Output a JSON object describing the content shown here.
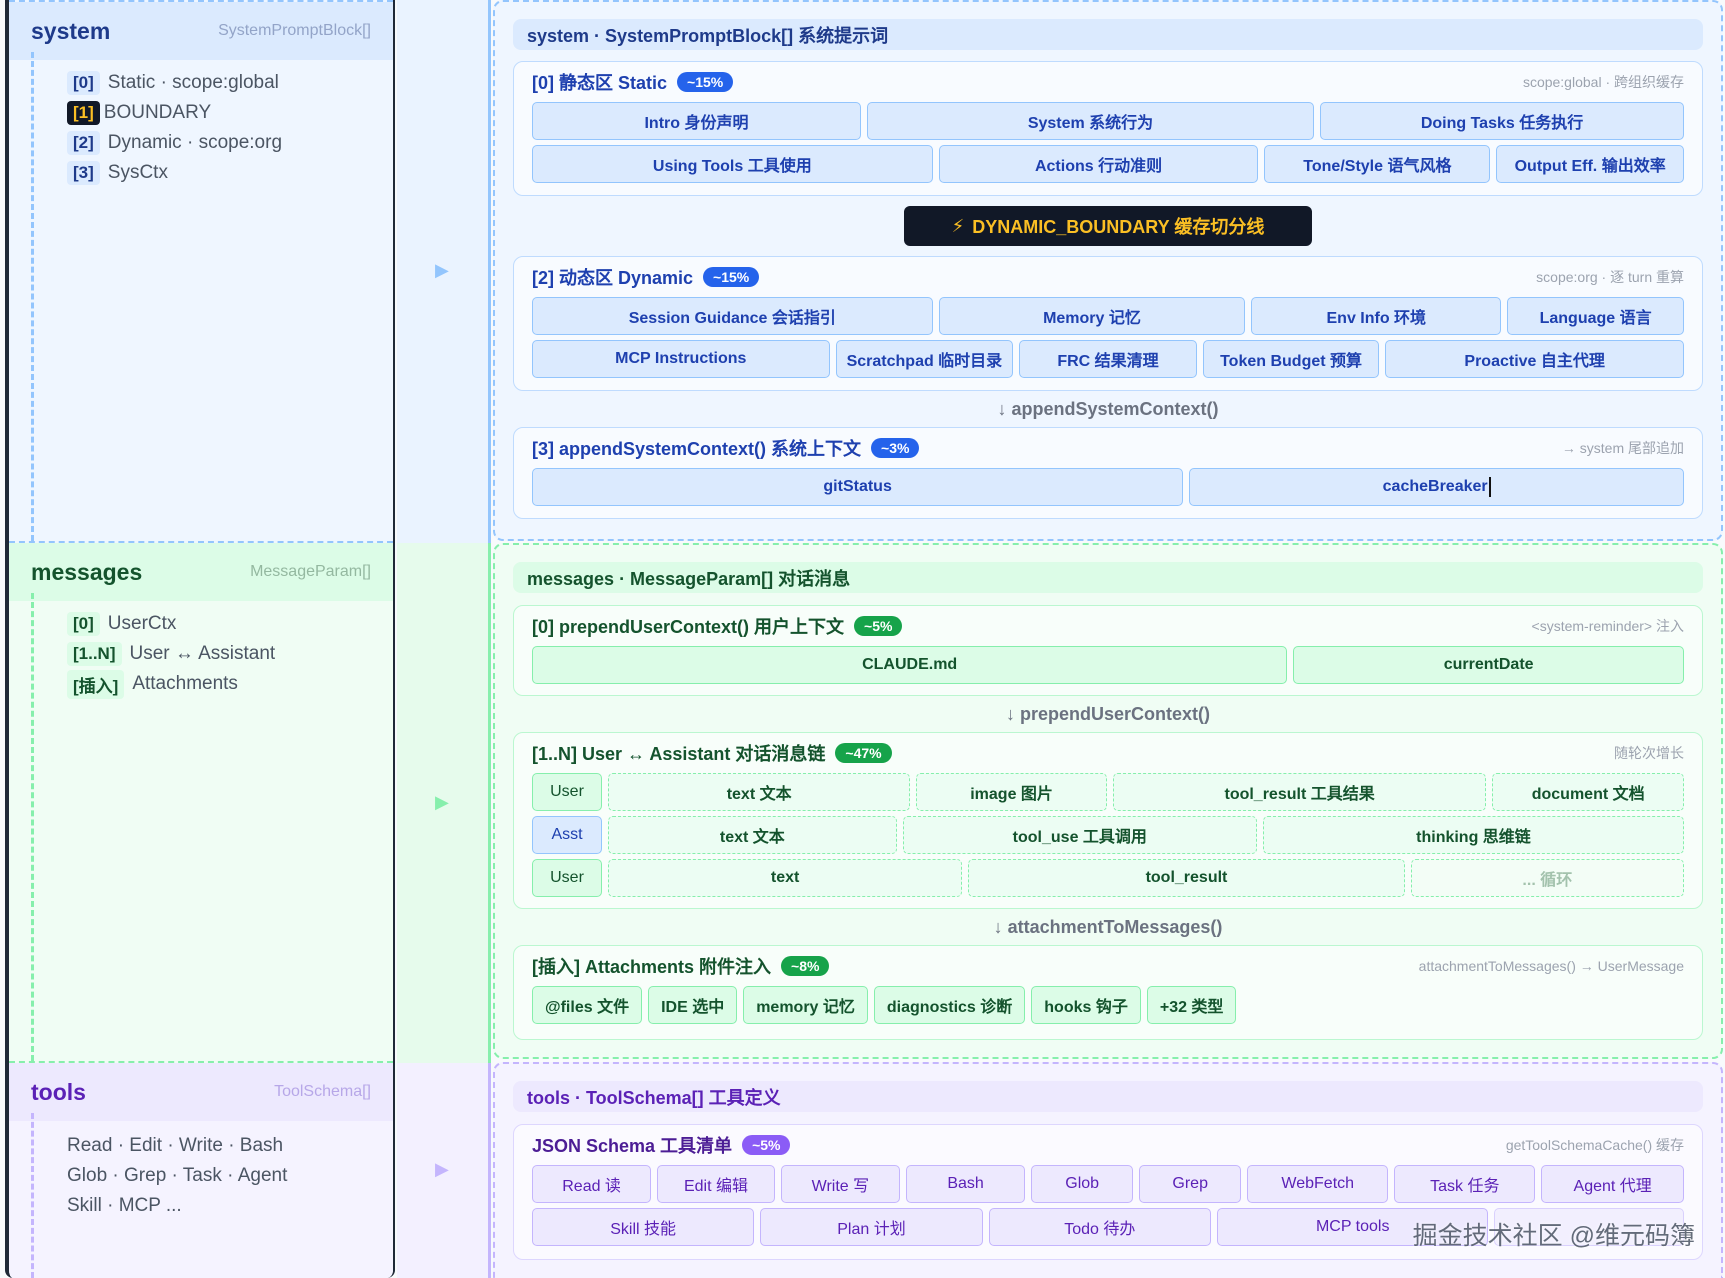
{
  "left": {
    "system": {
      "title": "system",
      "type": "SystemPromptBlock[]",
      "items": [
        {
          "idx": "[0]",
          "label": "Static · scope:global"
        },
        {
          "idx": "[1]",
          "label": "BOUNDARY"
        },
        {
          "idx": "[2]",
          "label": "Dynamic · scope:org"
        },
        {
          "idx": "[3]",
          "label": "SysCtx"
        }
      ]
    },
    "messages": {
      "title": "messages",
      "type": "MessageParam[]",
      "items": [
        {
          "idx": "[0]",
          "label": "UserCtx"
        },
        {
          "idx": "[1..N]",
          "label": "User ↔ Assistant"
        },
        {
          "idx": "[插入]",
          "label": "Attachments"
        }
      ]
    },
    "tools": {
      "title": "tools",
      "type": "ToolSchema[]",
      "lines": [
        "Read · Edit · Write · Bash",
        "Glob · Grep · Task · Agent",
        "Skill · MCP ..."
      ]
    }
  },
  "gutter": {
    "arrow_icon": "play-triangle",
    "colors": {
      "system": "#93c5fd",
      "messages": "#86efac",
      "tools": "#c4b5fd"
    }
  },
  "system": {
    "header": "system · SystemPromptBlock[] 系统提示词",
    "static": {
      "title": "[0] 静态区 Static",
      "badge": "~15%",
      "note": "scope:global · 跨组织缓存",
      "rows": [
        [
          "Intro 身份声明",
          "System 系统行为",
          "Doing Tasks 任务执行"
        ],
        [
          "Using Tools 工具使用",
          "Actions 行动准则",
          "Tone/Style 语气风格",
          "Output Eff. 输出效率"
        ]
      ]
    },
    "boundary": {
      "icon": "lightning-icon",
      "label": "DYNAMIC_BOUNDARY 缓存切分线"
    },
    "dynamic": {
      "title": "[2] 动态区 Dynamic",
      "badge": "~15%",
      "note": "scope:org · 逐 turn 重算",
      "rows": [
        [
          "Session Guidance 会话指引",
          "Memory 记忆",
          "Env Info 环境",
          "Language 语言"
        ],
        [
          "MCP Instructions",
          "Scratchpad 临时目录",
          "FRC 结果清理",
          "Token Budget 预算",
          "Proactive 自主代理"
        ]
      ]
    },
    "flow": "↓ appendSystemContext()",
    "append": {
      "title": "[3] appendSystemContext() 系统上下文",
      "badge": "~3%",
      "note": "→ system 尾部追加",
      "rows": [
        [
          "gitStatus",
          "cacheBreaker"
        ]
      ]
    }
  },
  "messages": {
    "header": "messages · MessageParam[] 对话消息",
    "prepend": {
      "title": "[0] prependUserContext() 用户上下文",
      "badge": "~5%",
      "note": "<system-reminder> 注入",
      "rows": [
        [
          "CLAUDE.md",
          "currentDate"
        ]
      ]
    },
    "flow1": "↓ prependUserContext()",
    "chain": {
      "title": "[1..N] User ↔ Assistant 对话消息链",
      "badge": "~47%",
      "note": "随轮次增长",
      "rows": [
        {
          "role": "User",
          "blocks": [
            "text 文本",
            "image 图片",
            "tool_result 工具结果",
            "document 文档"
          ]
        },
        {
          "role": "Asst",
          "blocks": [
            "text 文本",
            "tool_use 工具调用",
            "thinking 思维链"
          ]
        },
        {
          "role": "User",
          "blocks": [
            "text",
            "tool_result",
            "... 循环"
          ]
        }
      ]
    },
    "flow2": "↓ attachmentToMessages()",
    "attach": {
      "title": "[插入] Attachments 附件注入",
      "badge": "~8%",
      "note": "attachmentToMessages() → UserMessage",
      "rows": [
        [
          "@files 文件",
          "IDE 选中",
          "memory 记忆",
          "diagnostics 诊断",
          "hooks 钩子",
          "+32 类型"
        ]
      ]
    }
  },
  "tools": {
    "header": "tools · ToolSchema[] 工具定义",
    "schema": {
      "title": "JSON Schema 工具清单",
      "badge": "~5%",
      "note": "getToolSchemaCache() 缓存",
      "rows": [
        [
          "Read 读",
          "Edit 编辑",
          "Write 写",
          "Bash",
          "Glob",
          "Grep",
          "WebFetch",
          "Task 任务",
          "Agent 代理"
        ],
        [
          "Skill 技能",
          "Plan 计划",
          "Todo 待办",
          "MCP tools",
          ""
        ]
      ]
    }
  },
  "watermark": "掘金技术社区 @维元码簿",
  "colors": {
    "system": "#2563eb",
    "messages": "#16a34a",
    "tools": "#8b5cf6",
    "boundary": "#fbbf24"
  }
}
